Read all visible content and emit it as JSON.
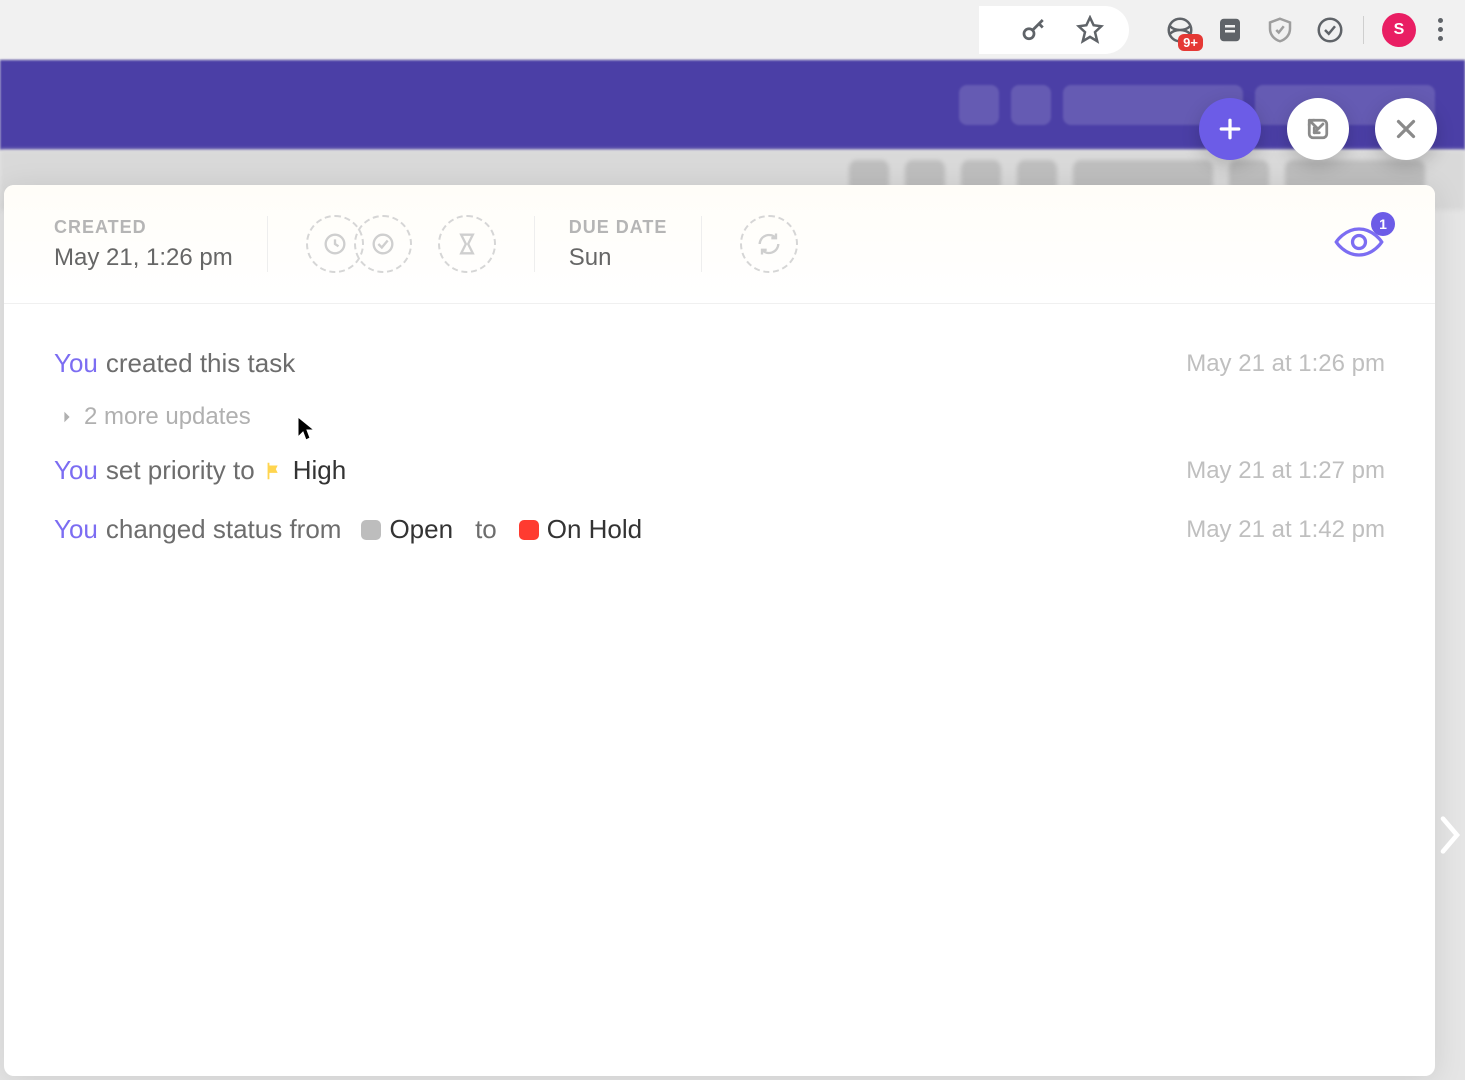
{
  "browser": {
    "ext_badge": "9+",
    "avatar_letter": "S"
  },
  "fab": {
    "add": "+"
  },
  "header": {
    "created_label": "CREATED",
    "created_value": "May 21, 1:26 pm",
    "due_label": "DUE DATE",
    "due_value": "Sun",
    "watch_count": "1"
  },
  "feed": {
    "row1": {
      "actor": "You",
      "text": "created this task",
      "ts": "May 21 at 1:26 pm"
    },
    "more": "2 more updates",
    "row2": {
      "actor": "You",
      "text": "set priority to",
      "priority": "High",
      "ts": "May 21 at 1:27 pm"
    },
    "row3": {
      "actor": "You",
      "text1": "changed status from",
      "status_from": "Open",
      "mid": "to",
      "status_to": "On Hold",
      "ts": "May 21 at 1:42 pm"
    }
  }
}
